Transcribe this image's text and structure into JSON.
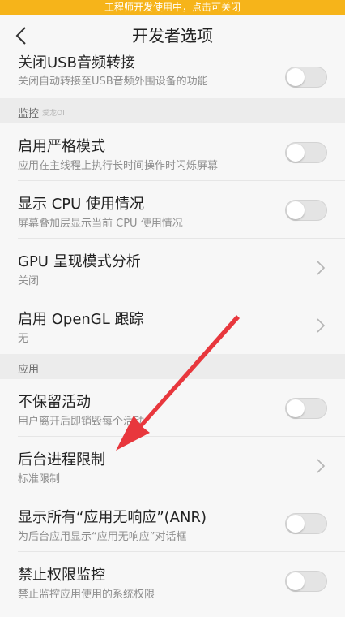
{
  "banner": {
    "text": "工程师开发使用中，点击可关闭"
  },
  "header": {
    "title": "开发者选项"
  },
  "items": [
    {
      "title": "关闭USB音频转接",
      "subtitle": "关闭自动转接至USB音频外围设备的功能",
      "control": "toggle",
      "on": false
    },
    {
      "section": "监控",
      "watermark": "爱龙OI"
    },
    {
      "title": "启用严格模式",
      "subtitle": "应用在主线程上执行长时间操作时闪烁屏幕",
      "control": "toggle",
      "on": false
    },
    {
      "title": "显示 CPU 使用情况",
      "subtitle": "屏幕叠加层显示当前 CPU 使用情况",
      "control": "toggle",
      "on": false
    },
    {
      "title": "GPU 呈现模式分析",
      "subtitle": "关闭",
      "control": "chevron"
    },
    {
      "title": "启用 OpenGL 跟踪",
      "subtitle": "无",
      "control": "chevron"
    },
    {
      "section": "应用"
    },
    {
      "title": "不保留活动",
      "subtitle": "用户离开后即销毁每个活动",
      "control": "toggle",
      "on": false
    },
    {
      "title": "后台进程限制",
      "subtitle": "标准限制",
      "control": "chevron"
    },
    {
      "title": "显示所有“应用无响应”(ANR)",
      "subtitle": "为后台应用显示“应用无响应”对话框",
      "control": "toggle",
      "on": false
    },
    {
      "title": "禁止权限监控",
      "subtitle": "禁止监控应用使用的系统权限",
      "control": "toggle",
      "on": false
    }
  ],
  "colors": {
    "banner": "#f6b41a",
    "arrow": "#e8373d"
  }
}
